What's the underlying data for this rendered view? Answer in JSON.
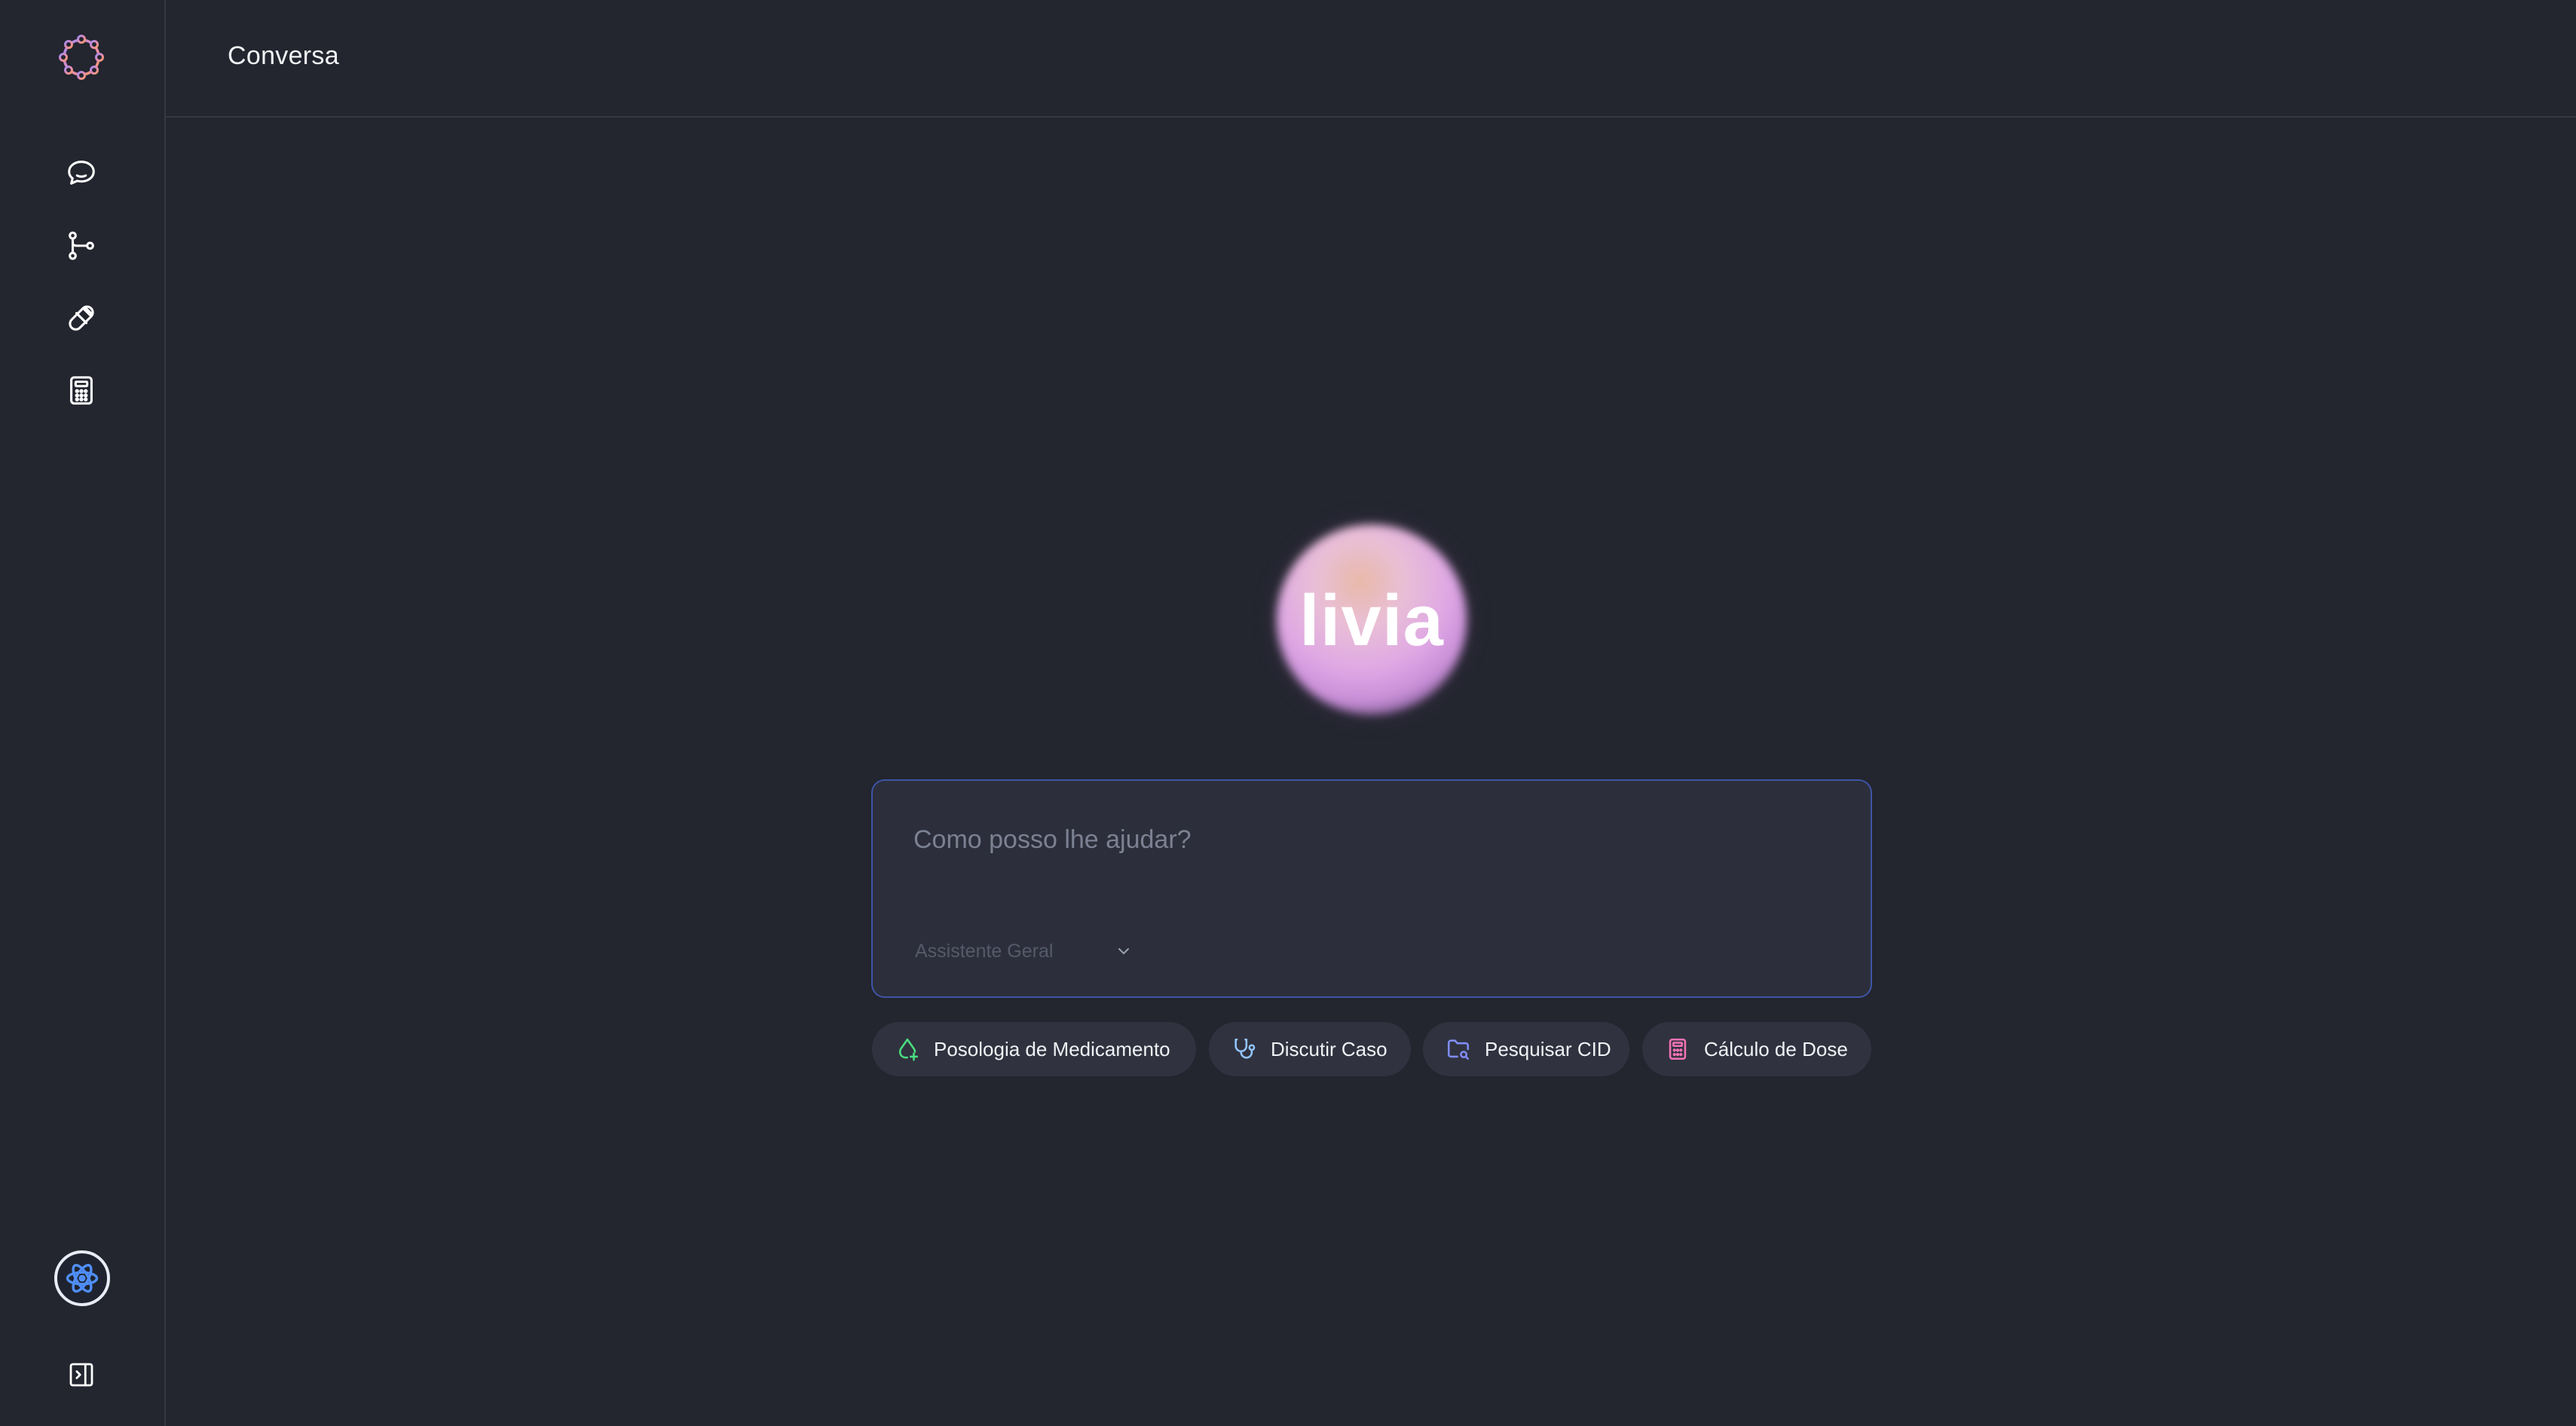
{
  "header": {
    "title": "Conversa"
  },
  "orb": {
    "label": "livia"
  },
  "chat": {
    "placeholder": "Como posso lhe ajudar?",
    "assistant_mode": "Assistente Geral"
  },
  "suggestions": [
    {
      "label": "Posologia de Medicamento",
      "icon": "drop-plus-icon",
      "color": "#4ade80"
    },
    {
      "label": "Discutir Caso",
      "icon": "stethoscope-icon",
      "color": "#93c5fd"
    },
    {
      "label": "Pesquisar CID",
      "icon": "folder-search-icon",
      "color": "#818cf8"
    },
    {
      "label": "Cálculo de Dose",
      "icon": "calculator-icon",
      "color": "#f472b6"
    }
  ],
  "sidebar": {
    "items": [
      {
        "name": "chat",
        "icon": "chat-bubble-icon"
      },
      {
        "name": "flows",
        "icon": "git-branch-icon"
      },
      {
        "name": "medications",
        "icon": "pill-icon"
      },
      {
        "name": "calculator",
        "icon": "calculator-icon"
      }
    ]
  },
  "colors": {
    "background": "#23252f",
    "input_border": "#3e55a6",
    "chip_background": "#30333f"
  }
}
